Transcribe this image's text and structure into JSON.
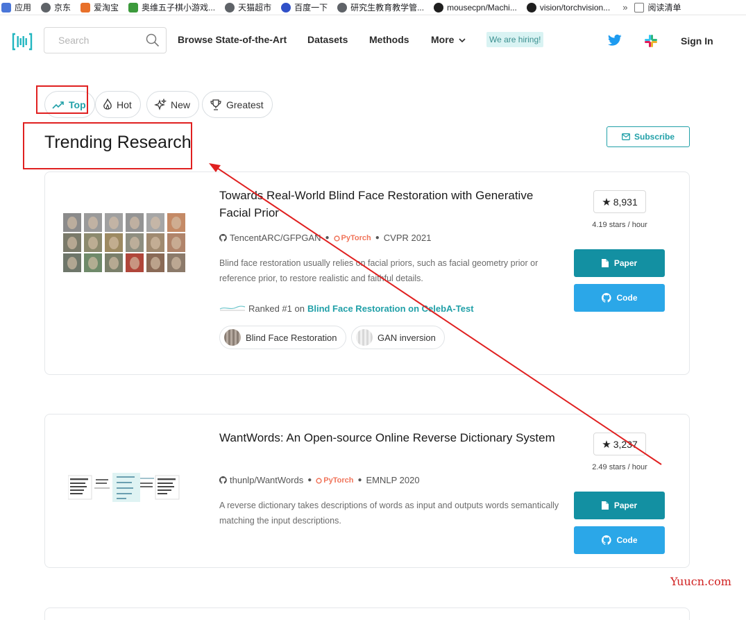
{
  "bookmarks": [
    {
      "label": "应用",
      "color": "#4a76d8"
    },
    {
      "label": "京东",
      "color": "#5f6368"
    },
    {
      "label": "爱淘宝",
      "color": "#e8702a"
    },
    {
      "label": "奥维五子棋小游戏...",
      "color": "#3c9a3c"
    },
    {
      "label": "天猫超市",
      "color": "#5f6368"
    },
    {
      "label": "百度一下",
      "color": "#3050c8"
    },
    {
      "label": "研究生教育教学管...",
      "color": "#5f6368"
    },
    {
      "label": "mousecpn/Machi...",
      "color": "#1f1f1f"
    },
    {
      "label": "vision/torchvision...",
      "color": "#1f1f1f"
    }
  ],
  "bookmarks_more": "»",
  "bookmarks_reading": "阅读清单",
  "navbar": {
    "search_placeholder": "Search",
    "links": [
      "Browse State-of-the-Art",
      "Datasets",
      "Methods",
      "More"
    ],
    "hiring": "We are hiring!",
    "signin": "Sign In"
  },
  "filters": [
    "Top",
    "Hot",
    "New",
    "Greatest"
  ],
  "page_title": "Trending Research",
  "subscribe": "Subscribe",
  "papers": [
    {
      "title": "Towards Real-World Blind Face Restoration with Generative Facial Prior",
      "repo": "TencentARC/GFPGAN",
      "framework": "PyTorch",
      "venue": "CVPR 2021",
      "description": "Blind face restoration usually relies on facial priors, such as facial geometry prior or reference prior, to restore realistic and faithful details.",
      "ranked_prefix": "Ranked #1 on",
      "ranked_link": "Blind Face Restoration on CelebA-Test",
      "tags": [
        "Blind Face Restoration",
        "GAN inversion"
      ],
      "stars": "8,931",
      "rate": "4.19 stars / hour",
      "paper_label": "Paper",
      "code_label": "Code"
    },
    {
      "title": "WantWords: An Open-source Online Reverse Dictionary System",
      "repo": "thunlp/WantWords",
      "framework": "PyTorch",
      "venue": "EMNLP 2020",
      "description": "A reverse dictionary takes descriptions of words as input and outputs words semantically matching the input descriptions.",
      "stars": "3,237",
      "rate": "2.49 stars / hour",
      "paper_label": "Paper",
      "code_label": "Code"
    }
  ],
  "watermark": "Yuucn.com",
  "colors": {
    "accent": "#21a0a8",
    "paper_button": "#1390a2",
    "code_button": "#2ba7e8",
    "annotation": "#e02020"
  }
}
